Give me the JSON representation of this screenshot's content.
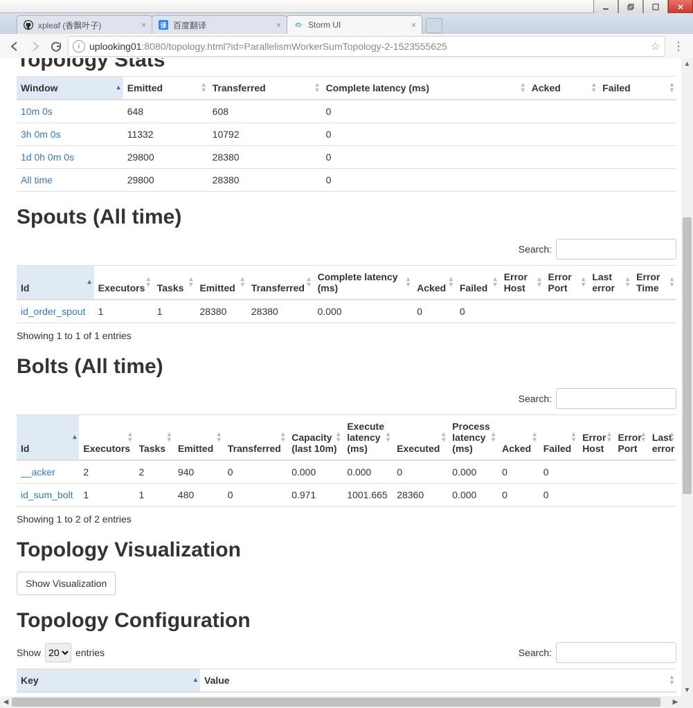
{
  "chrome": {
    "tabs": [
      {
        "label": "xpleaf (香飘叶子)"
      },
      {
        "label": "百度翻译"
      },
      {
        "label": "Storm UI"
      }
    ],
    "url_host": "uplooking01",
    "url_rest": ":8080/topology.html?id=ParallelismWorkerSumTopology-2-1523555625"
  },
  "sections": {
    "cutoff_title": "Topology Stats",
    "spouts": "Spouts (All time)",
    "bolts": "Bolts (All time)",
    "viz": "Topology Visualization",
    "config": "Topology Configuration"
  },
  "labels": {
    "search": "Search:",
    "show": "Show",
    "entries": "entries",
    "show_viz": "Show Visualization"
  },
  "topology_stats": {
    "headers": [
      "Window",
      "Emitted",
      "Transferred",
      "Complete latency (ms)",
      "Acked",
      "Failed"
    ],
    "rows": [
      {
        "window": "10m 0s",
        "emitted": "648",
        "transferred": "608",
        "latency": "0",
        "acked": "",
        "failed": ""
      },
      {
        "window": "3h 0m 0s",
        "emitted": "11332",
        "transferred": "10792",
        "latency": "0",
        "acked": "",
        "failed": ""
      },
      {
        "window": "1d 0h 0m 0s",
        "emitted": "29800",
        "transferred": "28380",
        "latency": "0",
        "acked": "",
        "failed": ""
      },
      {
        "window": "All time",
        "emitted": "29800",
        "transferred": "28380",
        "latency": "0",
        "acked": "",
        "failed": ""
      }
    ]
  },
  "spouts": {
    "headers": [
      "Id",
      "Executors",
      "Tasks",
      "Emitted",
      "Transferred",
      "Complete latency (ms)",
      "Acked",
      "Failed",
      "Error Host",
      "Error Port",
      "Last error",
      "Error Time"
    ],
    "rows": [
      {
        "id": "id_order_spout",
        "executors": "1",
        "tasks": "1",
        "emitted": "28380",
        "transferred": "28380",
        "latency": "0.000",
        "acked": "0",
        "failed": "0",
        "eh": "",
        "ep": "",
        "le": "",
        "et": ""
      }
    ],
    "info": "Showing 1 to 1 of 1 entries"
  },
  "bolts": {
    "headers": [
      "Id",
      "Executors",
      "Tasks",
      "Emitted",
      "Transferred",
      "Capacity (last 10m)",
      "Execute latency (ms)",
      "Executed",
      "Process latency (ms)",
      "Acked",
      "Failed",
      "Error Host",
      "Error Port",
      "Last error"
    ],
    "rows": [
      {
        "id": "__acker",
        "executors": "2",
        "tasks": "2",
        "emitted": "940",
        "transferred": "0",
        "capacity": "0.000",
        "exlat": "0.000",
        "executed": "0",
        "proclat": "0.000",
        "acked": "0",
        "failed": "0",
        "eh": "",
        "ep": "",
        "le": ""
      },
      {
        "id": "id_sum_bolt",
        "executors": "1",
        "tasks": "1",
        "emitted": "480",
        "transferred": "0",
        "capacity": "0.971",
        "exlat": "1001.665",
        "executed": "28360",
        "proclat": "0.000",
        "acked": "0",
        "failed": "0",
        "eh": "",
        "ep": "",
        "le": ""
      }
    ],
    "info": "Showing 1 to 2 of 2 entries"
  },
  "config": {
    "headers": [
      "Key",
      "Value"
    ],
    "page_size": "20"
  }
}
